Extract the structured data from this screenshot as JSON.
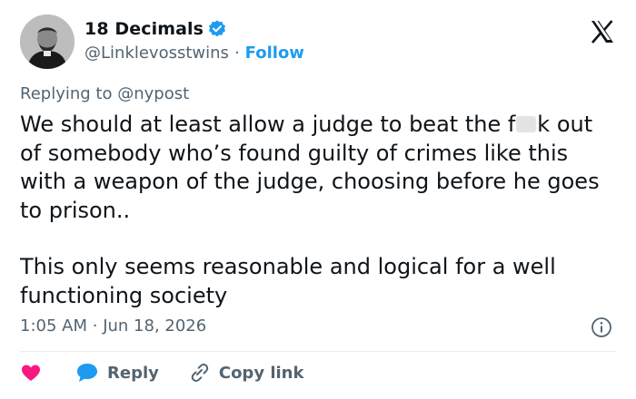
{
  "author": {
    "display_name": "18 Decimals",
    "handle": "@Linklevosstwins",
    "follow_label": "Follow",
    "separator": "·"
  },
  "reply": {
    "prefix": "Replying to",
    "mention": "@nypost"
  },
  "post": {
    "line1_before": "We should at least allow a judge to beat the f",
    "line1_after": "k",
    "paragraph1_rest": "out of somebody who’s found guilty of crimes like this with a weapon of the judge, choosing before he goes to prison..",
    "paragraph2": "This only seems reasonable and logical for a well functioning society"
  },
  "meta": {
    "time": "1:05 AM",
    "separator": "·",
    "date": "Jun 18, 2026"
  },
  "actions": {
    "reply_label": "Reply",
    "copy_link_label": "Copy link"
  },
  "icons": {
    "verified": "verified-badge-icon",
    "logo": "x-logo-icon",
    "info": "info-icon",
    "like": "heart-icon",
    "reply": "reply-bubble-icon",
    "copy": "link-icon"
  },
  "colors": {
    "accent": "#1d9bf0",
    "muted": "#536471",
    "like": "#f91880",
    "text": "#0f1419"
  }
}
